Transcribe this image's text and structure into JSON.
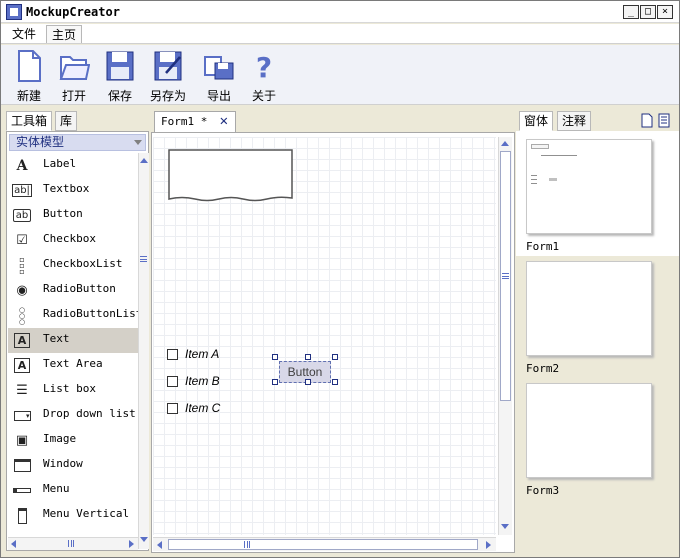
{
  "window": {
    "title": "MockupCreator"
  },
  "menubar": {
    "items": [
      "文件",
      "主页"
    ]
  },
  "toolbar": {
    "buttons": [
      {
        "label": "新建",
        "icon": "new-document-icon"
      },
      {
        "label": "打开",
        "icon": "open-folder-icon"
      },
      {
        "label": "保存",
        "icon": "save-disk-icon"
      },
      {
        "label": "另存为",
        "icon": "save-as-icon"
      },
      {
        "label": "导出",
        "icon": "export-icon"
      },
      {
        "label": "关于",
        "icon": "question-mark-icon"
      }
    ]
  },
  "left_panel": {
    "tabs": [
      "工具箱",
      "库"
    ],
    "group": "实体模型",
    "items": [
      {
        "label": "Label",
        "icon": "label-icon"
      },
      {
        "label": "Textbox",
        "icon": "textbox-icon"
      },
      {
        "label": "Button",
        "icon": "button-icon"
      },
      {
        "label": "Checkbox",
        "icon": "checkbox-icon"
      },
      {
        "label": "CheckboxList",
        "icon": "checkbox-list-icon"
      },
      {
        "label": "RadioButton",
        "icon": "radio-button-icon"
      },
      {
        "label": "RadioButtonList",
        "icon": "radio-button-list-icon"
      },
      {
        "label": "Text",
        "icon": "text-icon"
      },
      {
        "label": "Text Area",
        "icon": "text-area-icon"
      },
      {
        "label": "List box",
        "icon": "list-box-icon"
      },
      {
        "label": "Drop down list",
        "icon": "drop-down-list-icon"
      },
      {
        "label": "Image",
        "icon": "image-icon"
      },
      {
        "label": "Window",
        "icon": "window-icon"
      },
      {
        "label": "Menu",
        "icon": "menu-icon"
      },
      {
        "label": "Menu Vertical",
        "icon": "menu-vertical-icon"
      }
    ],
    "selected_index": 7
  },
  "canvas": {
    "tab_label": "Form1 *",
    "checkbox_items": [
      "Item A",
      "Item B",
      "Item C"
    ],
    "button_label": "Button"
  },
  "right_panel": {
    "tabs": [
      "窗体",
      "注释"
    ],
    "thumbnails": [
      "Form1",
      "Form2",
      "Form3"
    ]
  },
  "colors": {
    "accent": "#5a6fc6",
    "selection": "#d4d0c8",
    "group_header": "#d8dcf0"
  }
}
